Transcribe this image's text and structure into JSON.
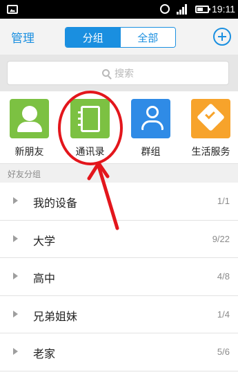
{
  "status_bar": {
    "time": "19:11"
  },
  "header": {
    "manage_label": "管理",
    "tabs": [
      {
        "label": "分组",
        "active": true
      },
      {
        "label": "全部",
        "active": false
      }
    ]
  },
  "search": {
    "placeholder": "搜索"
  },
  "quick_entries": [
    {
      "label": "新朋友",
      "icon": "new-friend-icon",
      "color": "#7cc142"
    },
    {
      "label": "通讯录",
      "icon": "contacts-book-icon",
      "color": "#7cc142"
    },
    {
      "label": "群组",
      "icon": "group-icon",
      "color": "#2f8be6"
    },
    {
      "label": "生活服务",
      "icon": "life-service-icon",
      "color": "#f7a32b"
    }
  ],
  "section_label": "好友分组",
  "friend_groups": [
    {
      "name": "我的设备",
      "count": "1/1"
    },
    {
      "name": "大学",
      "count": "9/22"
    },
    {
      "name": "高中",
      "count": "4/8"
    },
    {
      "name": "兄弟姐妹",
      "count": "1/4"
    },
    {
      "name": "老家",
      "count": "5/6"
    }
  ],
  "colors": {
    "accent": "#1a8fe0",
    "annotation": "#e3161c"
  }
}
